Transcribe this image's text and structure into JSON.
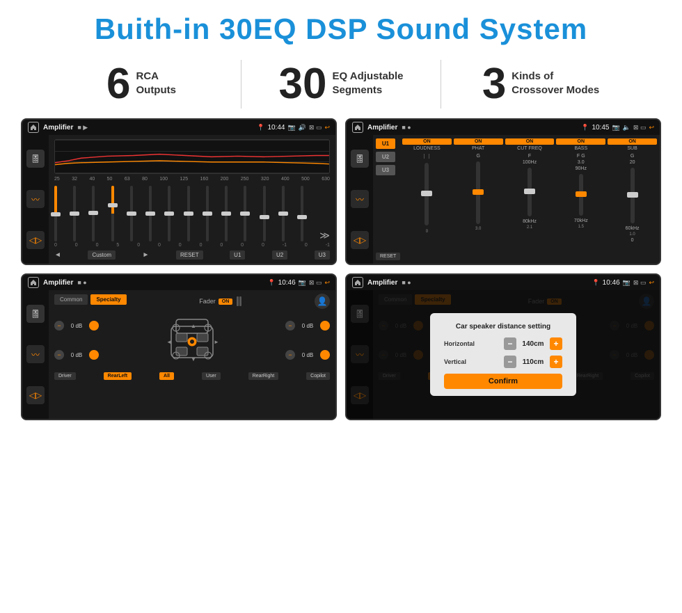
{
  "header": {
    "title": "Buith-in 30EQ DSP Sound System"
  },
  "stats": [
    {
      "number": "6",
      "text": "RCA\nOutputs"
    },
    {
      "number": "30",
      "text": "EQ Adjustable\nSegments"
    },
    {
      "number": "3",
      "text": "Kinds of\nCrossover Modes"
    }
  ],
  "screens": [
    {
      "id": "eq-screen",
      "statusBar": {
        "title": "Amplifier",
        "icons": "■ ▶",
        "time": "10:44"
      },
      "type": "eq"
    },
    {
      "id": "crossover-screen",
      "statusBar": {
        "title": "Amplifier",
        "icons": "■ ●",
        "time": "10:45"
      },
      "type": "crossover"
    },
    {
      "id": "fader-screen",
      "statusBar": {
        "title": "Amplifier",
        "icons": "■ ●",
        "time": "10:46"
      },
      "type": "fader"
    },
    {
      "id": "dialog-screen",
      "statusBar": {
        "title": "Amplifier",
        "icons": "■ ●",
        "time": "10:46"
      },
      "type": "dialog",
      "dialog": {
        "title": "Car speaker distance setting",
        "horizontal": {
          "label": "Horizontal",
          "value": "140cm"
        },
        "vertical": {
          "label": "Vertical",
          "value": "110cm"
        },
        "confirm": "Confirm"
      }
    }
  ],
  "eq": {
    "freqs": [
      "25",
      "32",
      "40",
      "50",
      "63",
      "80",
      "100",
      "125",
      "160",
      "200",
      "250",
      "320",
      "400",
      "500",
      "630"
    ],
    "values": [
      "0",
      "0",
      "0",
      "5",
      "0",
      "0",
      "0",
      "0",
      "0",
      "0",
      "0",
      "-1",
      "0",
      "-1"
    ],
    "presets": [
      "Custom",
      "RESET",
      "U1",
      "U2",
      "U3"
    ]
  },
  "crossover": {
    "units": [
      "U1",
      "U2",
      "U3"
    ],
    "channels": [
      "LOUDNESS",
      "PHAT",
      "CUT FREQ",
      "BASS",
      "SUB"
    ]
  },
  "fader": {
    "tabs": [
      "Common",
      "Specialty"
    ],
    "label": "Fader",
    "dbs": [
      "0 dB",
      "0 dB",
      "0 dB",
      "0 dB"
    ],
    "bottomLabels": [
      "Driver",
      "RearLeft",
      "All",
      "User",
      "RearRight",
      "Copilot"
    ]
  },
  "dialog": {
    "title": "Car speaker distance setting",
    "horizontal_label": "Horizontal",
    "horizontal_value": "140cm",
    "vertical_label": "Vertical",
    "vertical_value": "110cm",
    "confirm": "Confirm"
  }
}
